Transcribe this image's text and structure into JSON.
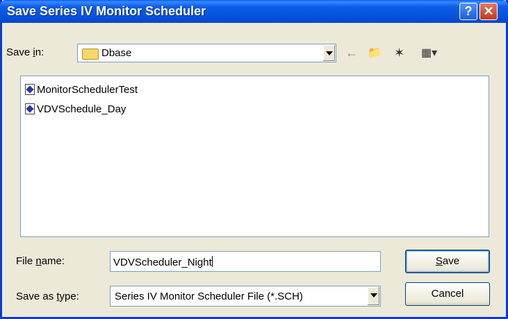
{
  "window": {
    "title": "Save Series IV Monitor Scheduler",
    "help_glyph": "?",
    "close_glyph": "✕"
  },
  "toolbar": {
    "save_in_label_pre": "Save ",
    "save_in_label_u": "i",
    "save_in_label_post": "n:",
    "location_value": "Dbase",
    "back_icon": "←",
    "up_icon": "📁",
    "new_folder_icon": "✶",
    "views_icon": "▦▾"
  },
  "files": [
    {
      "name": "MonitorSchedulerTest"
    },
    {
      "name": "VDVSchedule_Day"
    }
  ],
  "filename": {
    "label_pre": "File ",
    "label_u": "n",
    "label_post": "ame:",
    "value": "VDVScheduler_Night"
  },
  "filetype": {
    "label_pre": "Save as ",
    "label_u": "t",
    "label_post": "ype:",
    "value": "Series IV Monitor Scheduler File (*.SCH)"
  },
  "buttons": {
    "save_u": "S",
    "save_rest": "ave",
    "cancel": "Cancel"
  }
}
